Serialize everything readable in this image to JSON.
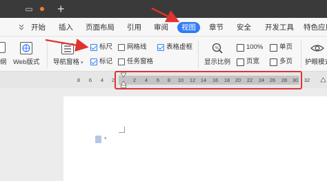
{
  "tabs": [
    "开始",
    "插入",
    "页面布局",
    "引用",
    "审阅",
    "视图",
    "章节",
    "安全",
    "开发工具",
    "特色应用"
  ],
  "active_tab": "视图",
  "ribbon": {
    "left_cut_label": "纲",
    "web_layout": "Web版式",
    "nav_pane": "导航窗格",
    "checkboxes": {
      "ruler": "标尺",
      "gridlines": "网格线",
      "table_gridlines": "表格虚框",
      "marks": "标记",
      "task_pane": "任务窗格"
    },
    "zoom_label": "显示比例",
    "zoom_100": "100%",
    "page_width": "页宽",
    "single_page": "单页",
    "multi_page": "多页",
    "eye_protect": "护眼模式"
  },
  "ruler": {
    "left_ticks": [
      "8",
      "6",
      "4",
      "2"
    ],
    "right_ticks": [
      "2",
      "4",
      "6",
      "8",
      "10",
      "12",
      "14",
      "16",
      "18",
      "20",
      "22",
      "24",
      "26",
      "28",
      "30",
      "32"
    ]
  },
  "colors": {
    "accent": "#2E7CF6",
    "annotation": "#E0332F",
    "titlebar": "#3A3A3A",
    "ribbon": "#F7F7F7"
  }
}
